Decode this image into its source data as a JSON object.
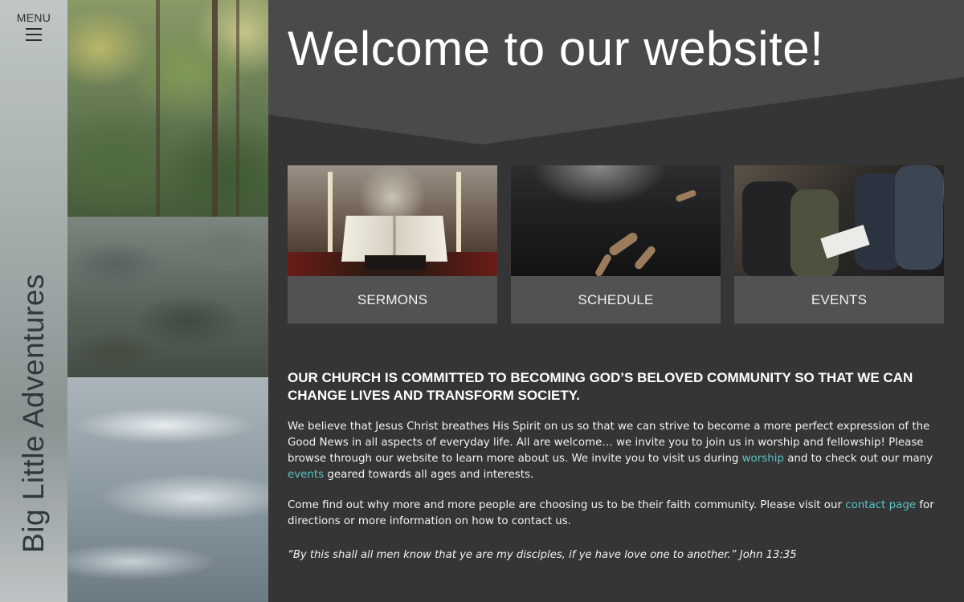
{
  "sidebar": {
    "menu_label": "MENU",
    "brand": "Big Little Adventures"
  },
  "hero": {
    "title": "Welcome to our website!"
  },
  "cards": [
    {
      "label": "SERMONS"
    },
    {
      "label": "SCHEDULE"
    },
    {
      "label": "EVENTS"
    }
  ],
  "content": {
    "heading": "OUR CHURCH IS COMMITTED TO BECOMING GOD’S BELOVED COMMUNITY SO THAT WE CAN CHANGE LIVES AND TRANSFORM SOCIETY.",
    "p1_a": "We believe that Jesus Christ breathes His Spirit on us so that we can strive to become a more perfect expression of the Good News in all aspects of everyday life. All are welcome… we invite you to join us in worship and fellowship! Please browse through our website to learn more about us. We invite you to visit us during ",
    "p1_link1": "worship",
    "p1_b": " and to check out our many ",
    "p1_link2": "events",
    "p1_c": " geared towards all ages and interests.",
    "p2_a": "Come find out why more and more people are choosing us to be their faith community. Please visit our ",
    "p2_link": "contact page",
    "p2_b": " for directions or more information on how to contact us.",
    "quote": "“By this shall all men know that ye are my disciples, if ye have love one to another.” John 13:35"
  },
  "colors": {
    "background": "#353535",
    "hero_band": "#4a4a4a",
    "card_caption": "#525252",
    "link": "#5bc3c9"
  },
  "icons": {
    "menu": "hamburger-icon"
  }
}
